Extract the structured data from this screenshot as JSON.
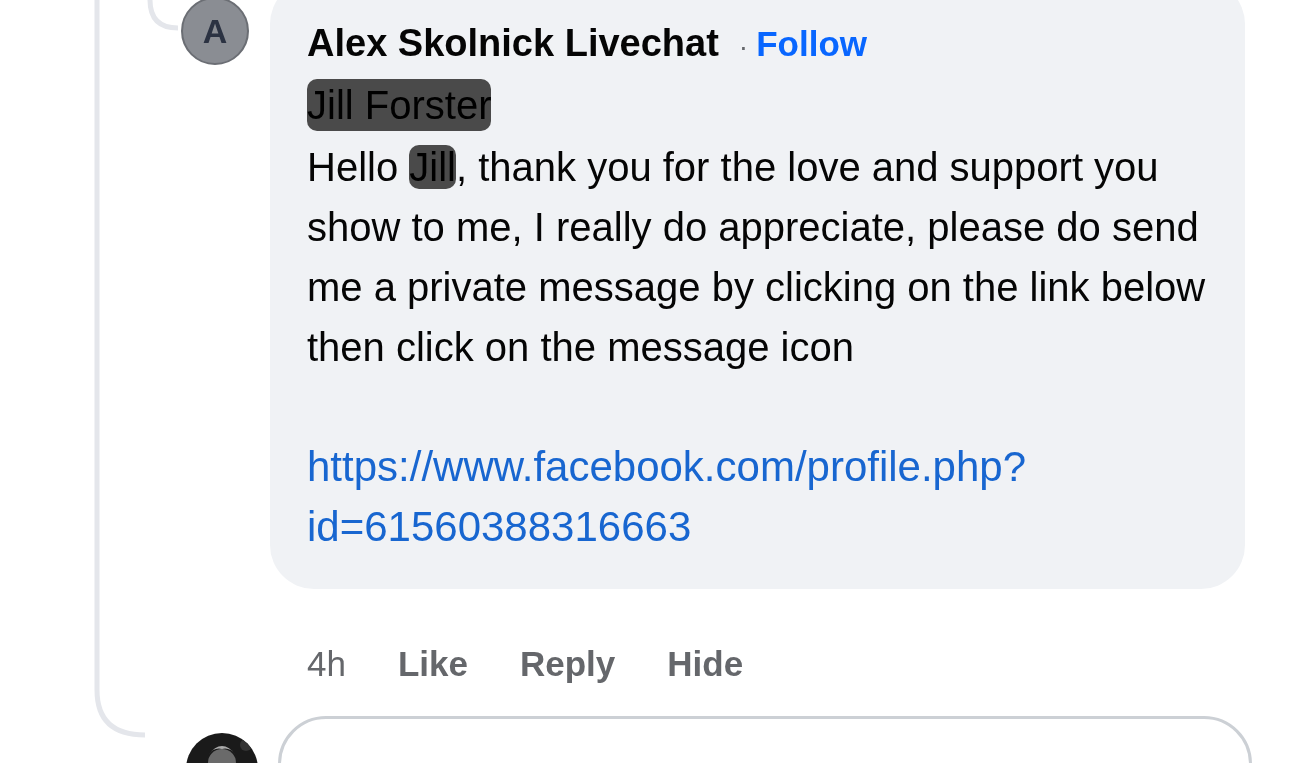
{
  "comment": {
    "avatar_letter": "A",
    "author": "Alex Skolnick Livechat",
    "separator": "·",
    "follow": "Follow",
    "mention": {
      "text": "Jill Forster",
      "redacted": true
    },
    "message": [
      {
        "text": "Hello ",
        "redacted": false
      },
      {
        "text": "Jill",
        "redacted": true
      },
      {
        "text": ", thank you for the love and support you show to me, I really do appreciate, please do send me a private message by clicking on the link below then click on the message icon",
        "redacted": false
      }
    ],
    "link_lines": [
      "https://www.facebook.com/profile.php?",
      "id=61560388316663"
    ],
    "time": "4h",
    "actions": [
      "Like",
      "Reply",
      "Hide"
    ]
  },
  "reply_box": {
    "kind": "field"
  }
}
